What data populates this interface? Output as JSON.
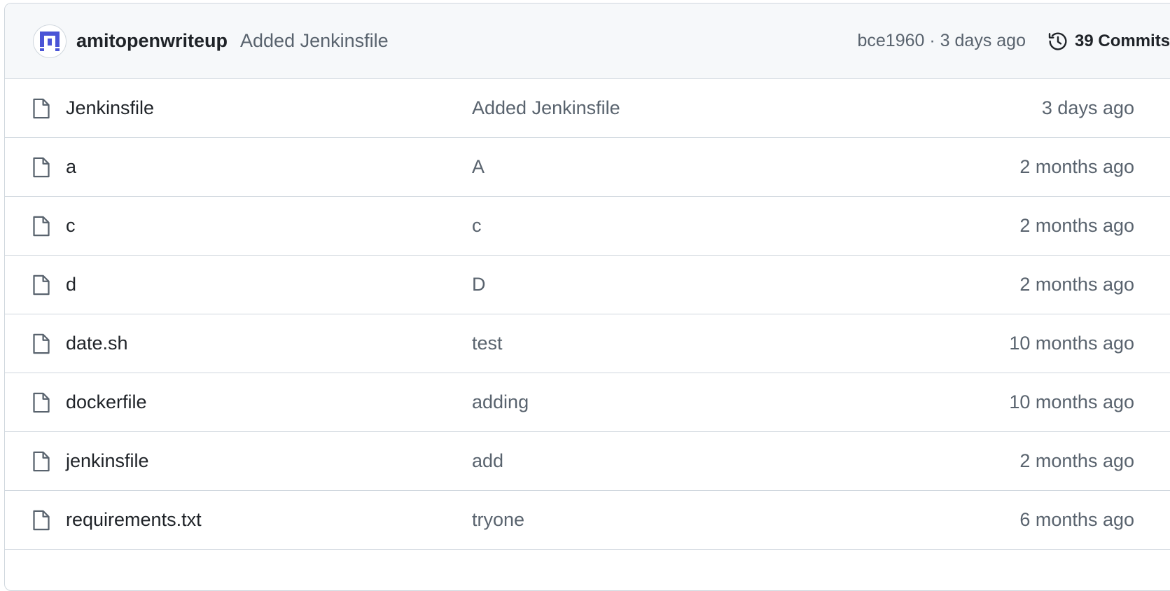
{
  "commit": {
    "author": "amitopenwriteup",
    "message": "Added Jenkinsfile",
    "sha": "bce1960",
    "separator": "·",
    "time": "3 days ago",
    "commits_label": "39 Commits"
  },
  "files": [
    {
      "name": "Jenkinsfile",
      "message": "Added Jenkinsfile",
      "date": "3 days ago"
    },
    {
      "name": "a",
      "message": "A",
      "date": "2 months ago"
    },
    {
      "name": "c",
      "message": "c",
      "date": "2 months ago"
    },
    {
      "name": "d",
      "message": "D",
      "date": "2 months ago"
    },
    {
      "name": "date.sh",
      "message": "test",
      "date": "10 months ago"
    },
    {
      "name": "dockerfile",
      "message": "adding",
      "date": "10 months ago"
    },
    {
      "name": "jenkinsfile",
      "message": "add",
      "date": "2 months ago"
    },
    {
      "name": "requirements.txt",
      "message": "tryone",
      "date": "6 months ago"
    }
  ],
  "colors": {
    "border": "#d0d7de",
    "header_bg": "#f6f8fa",
    "muted_text": "#59636e",
    "avatar_blue": "#4a54d6"
  },
  "icons": {
    "file": "file-icon",
    "history": "history-icon",
    "avatar": "avatar-identicon"
  }
}
